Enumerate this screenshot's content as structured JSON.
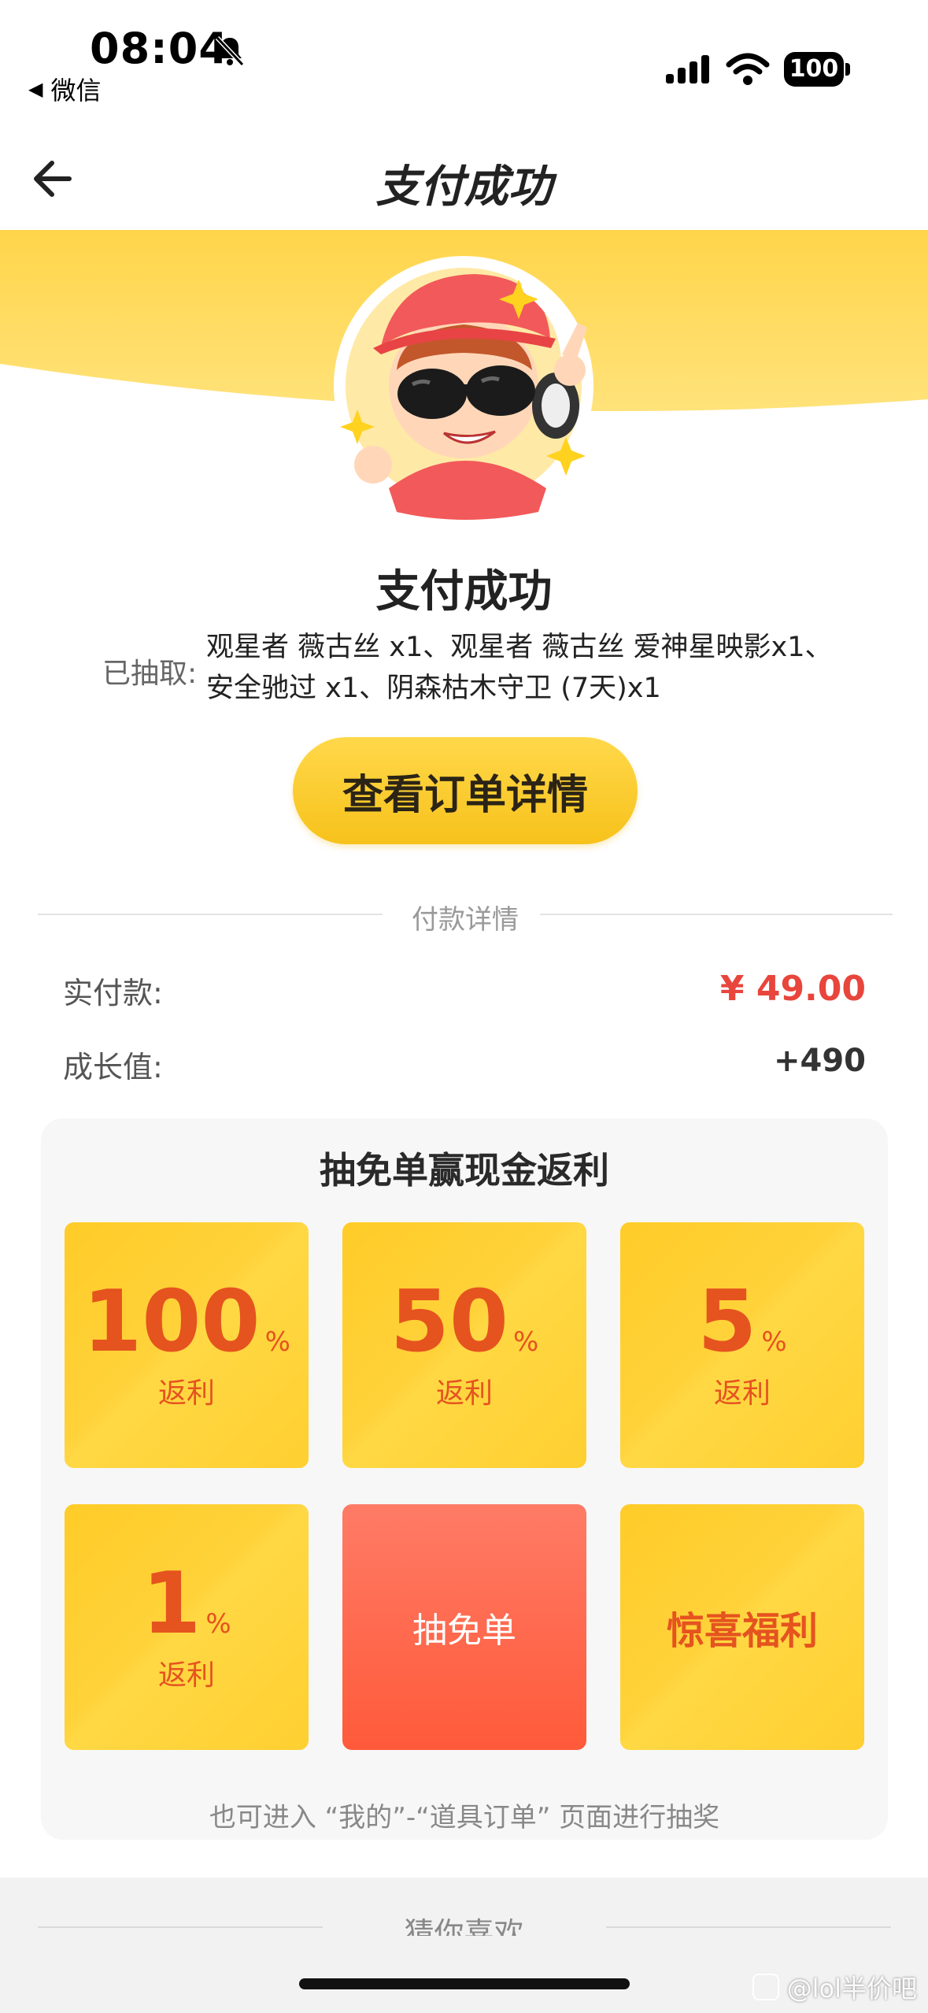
{
  "status_bar": {
    "time": "08:04",
    "back_app": "微信",
    "battery": "100"
  },
  "nav": {
    "title": "支付成功"
  },
  "result": {
    "title": "支付成功",
    "drawn_label": "已抽取:",
    "drawn_items": "观星者 薇古丝 x1、观星者 薇古丝 爱神星映影x1、安全驰过 x1、阴森枯木守卫 (7天)x1",
    "order_button": "查看订单详情"
  },
  "payment": {
    "section_title": "付款详情",
    "paid_label": "实付款:",
    "paid_value": "¥ 49.00",
    "growth_label": "成长值:",
    "growth_value": "+490"
  },
  "lottery": {
    "title": "抽免单赢现金返利",
    "tiles": [
      {
        "num": "100",
        "sign": "%",
        "sub": "返利"
      },
      {
        "num": "50",
        "sign": "%",
        "sub": "返利"
      },
      {
        "num": "5",
        "sign": "%",
        "sub": "返利"
      },
      {
        "num": "1",
        "sign": "%",
        "sub": "返利"
      }
    ],
    "draw_button": "抽免单",
    "surprise": "惊喜福利",
    "hint": "也可进入 “我的”-“道具订单” 页面进行抽奖"
  },
  "bottom": {
    "guess_title": "猜你喜欢"
  },
  "watermark": "@lol半价吧",
  "colors": {
    "accent_yellow": "#ffd23a",
    "price_red": "#e8453c",
    "tile_orange_text": "#e5531f"
  }
}
